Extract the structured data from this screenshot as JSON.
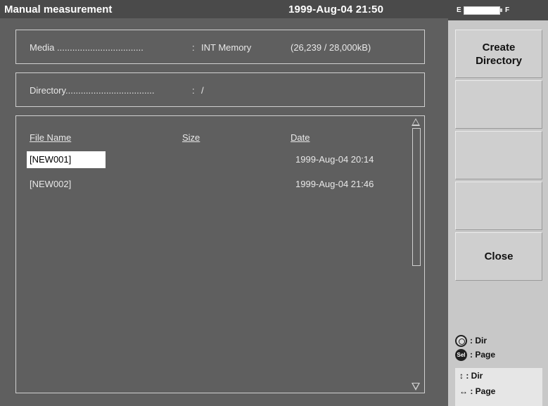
{
  "header": {
    "title": "Manual measurement",
    "datetime": "1999-Aug-04 21:50"
  },
  "battery": {
    "empty_label": "E",
    "full_label": "F"
  },
  "media": {
    "label": "Media ..................................",
    "separator": ":",
    "value": "INT Memory",
    "usage": "(26,239 / 28,000kB)"
  },
  "directory": {
    "label": "Directory...................................",
    "separator": ":",
    "value": "/"
  },
  "file_list": {
    "columns": {
      "name": "File Name",
      "size": "Size",
      "date": "Date"
    },
    "rows": [
      {
        "name": "[NEW001]",
        "size": "",
        "date": "1999-Aug-04 20:14",
        "selected": true
      },
      {
        "name": "[NEW002]",
        "size": "",
        "date": "1999-Aug-04 21:46",
        "selected": false
      }
    ]
  },
  "function_keys": [
    {
      "label": "Create\nDirectory"
    },
    {
      "label": ""
    },
    {
      "label": ""
    },
    {
      "label": ""
    },
    {
      "label": "Close"
    }
  ],
  "legend": {
    "rotary": {
      "icon": "rotary-knob-icon",
      "text": ": Dir"
    },
    "select": {
      "icon": "sel-button-icon",
      "icon_text": "Sel",
      "text": ": Page"
    },
    "updown": {
      "icon": "up-down-arrow-icon",
      "glyph": "↕",
      "text": ": Dir"
    },
    "leftright": {
      "icon": "left-right-arrow-icon",
      "glyph": "↔",
      "text": ": Page"
    }
  }
}
